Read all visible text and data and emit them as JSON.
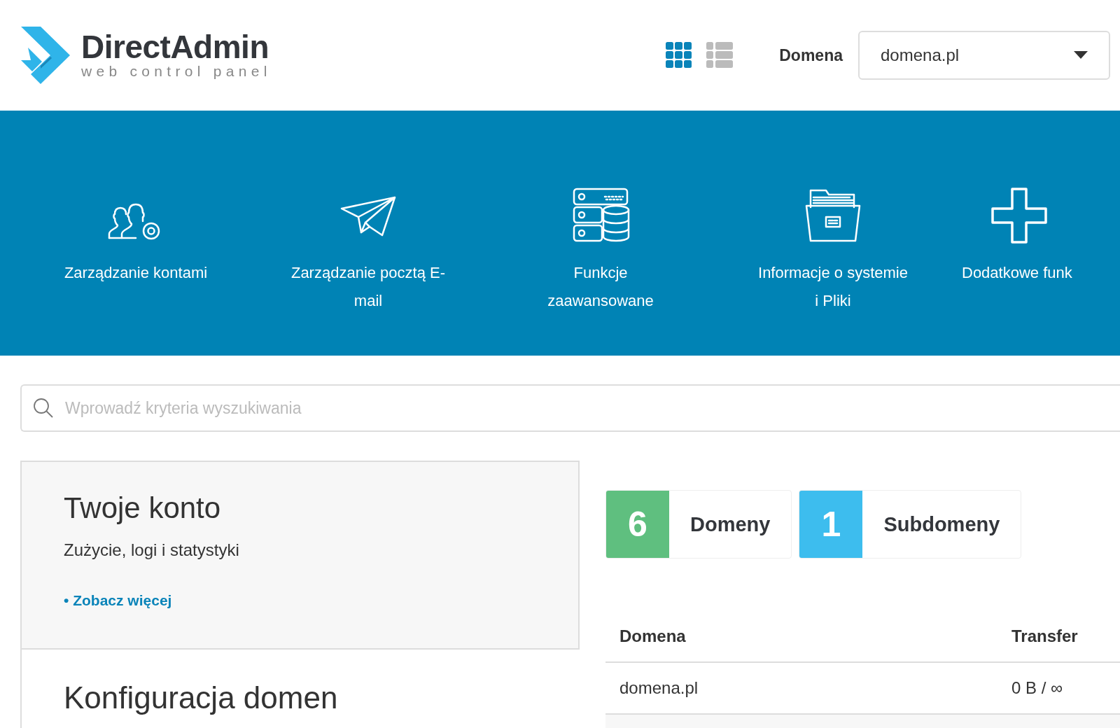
{
  "logo": {
    "title": "DirectAdmin",
    "subtitle": "web control panel"
  },
  "view_toggles": [
    {
      "kind": "grid",
      "selected": true
    },
    {
      "kind": "list",
      "selected": false
    }
  ],
  "domain_selector": {
    "label": "Domena",
    "value": "domena.pl"
  },
  "nav": [
    {
      "kind": "users",
      "label": "Zarządzanie kontami"
    },
    {
      "kind": "mail",
      "label": "Zarządzanie pocztą E-mail"
    },
    {
      "kind": "server",
      "label": "Funkcje zaawansowane"
    },
    {
      "kind": "folder",
      "label": "Informacje o systemie i Pliki"
    },
    {
      "kind": "plus",
      "label": "Dodatkowe funk"
    }
  ],
  "search": {
    "placeholder": "Wprowadź kryteria wyszukiwania"
  },
  "account_panel": {
    "title": "Twoje konto",
    "subtitle": "Zużycie, logi i statystyki",
    "link": "• Zobacz więcej"
  },
  "section_title": "Konfiguracja domen",
  "stats": [
    {
      "count": "6",
      "label": "Domeny",
      "color": "#5fbf7f"
    },
    {
      "count": "1",
      "label": "Subdomeny",
      "color": "#3dbdee"
    }
  ],
  "table": {
    "columns": [
      "Domena",
      "Transfer"
    ],
    "rows": [
      [
        "domena.pl",
        "0 B / ∞"
      ]
    ]
  }
}
